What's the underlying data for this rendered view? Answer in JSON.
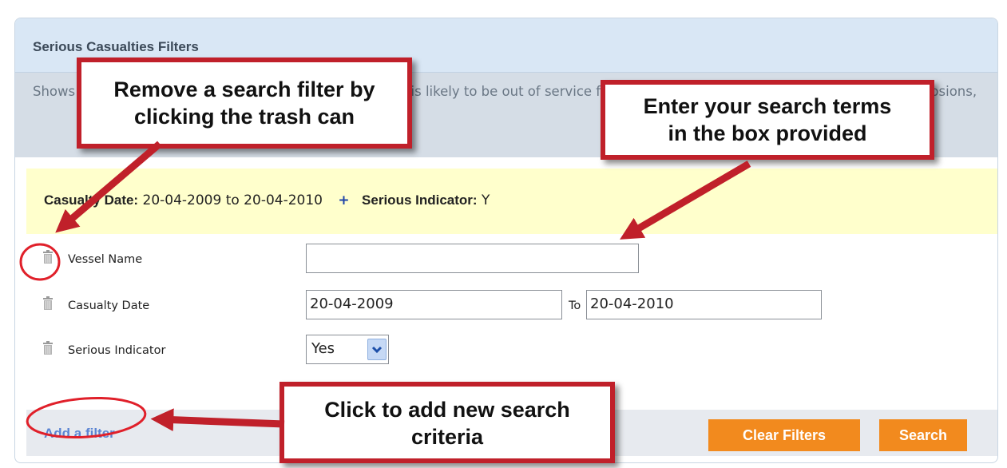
{
  "panel": {
    "title": "Serious Casualties Filters",
    "description": "Shows casualties involving a vessel that is a total loss or is likely to be out of service for a considerable period to include collisions, explosions, fires, groundings etc."
  },
  "summary": {
    "date_label": "Casualty Date:",
    "date_value": "20-04-2009 to 20-04-2010",
    "separator": "+",
    "indicator_label": "Serious Indicator:",
    "indicator_value": "Y"
  },
  "filters": [
    {
      "label": "Vessel Name",
      "value": ""
    },
    {
      "label": "Casualty Date",
      "from": "20-04-2009",
      "to_label": "To",
      "to": "20-04-2010"
    },
    {
      "label": "Serious Indicator",
      "selected": "Yes"
    }
  ],
  "footer": {
    "add_filter": "Add a filter",
    "clear_filters": "Clear Filters",
    "search": "Search"
  },
  "callouts": {
    "remove_filter": [
      "Remove a search filter by",
      "clicking the trash can"
    ],
    "search_terms": [
      "Enter your search terms",
      "in the box provided"
    ],
    "add_criteria": [
      "Click to add new search",
      "criteria"
    ]
  },
  "colors": {
    "accent_orange": "#f28a1e",
    "callout_red": "#c0202a",
    "link_blue": "#5b84d3",
    "summary_yellow": "#ffffcc"
  },
  "icons": [
    "trash-icon",
    "chevron-down-icon"
  ]
}
